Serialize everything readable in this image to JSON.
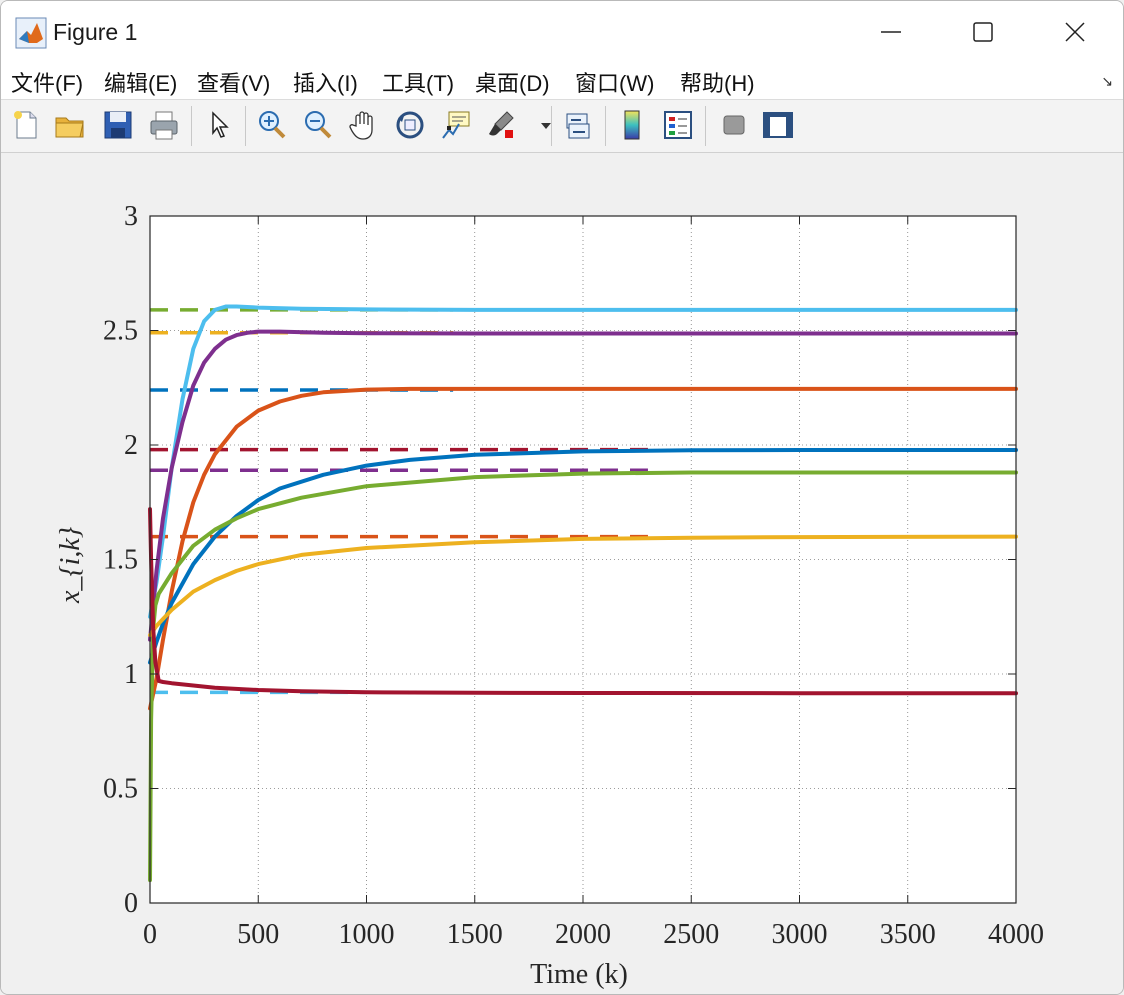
{
  "window": {
    "title": "Figure 1"
  },
  "menu": [
    "文件(F)",
    "编辑(E)",
    "查看(V)",
    "插入(I)",
    "工具(T)",
    "桌面(D)",
    "窗口(W)",
    "帮助(H)"
  ],
  "toolbar_icons": [
    "new-figure-icon",
    "open-file-icon",
    "save-icon",
    "print-icon",
    "select-arrow-icon",
    "zoom-in-icon",
    "zoom-out-icon",
    "pan-hand-icon",
    "rotate-3d-icon",
    "data-cursor-icon",
    "brush-icon",
    "brush-dropdown-icon",
    "link-plot-icon",
    "colorbar-icon",
    "legend-icon",
    "hide-plot-tools-icon",
    "show-plot-tools-icon"
  ],
  "chart_data": {
    "type": "line",
    "xlabel": "Time (k)",
    "ylabel": "x_{i,k}",
    "xlim": [
      0,
      4000
    ],
    "ylim": [
      0,
      3
    ],
    "xticks": [
      0,
      500,
      1000,
      1500,
      2000,
      2500,
      3000,
      3500,
      4000
    ],
    "yticks": [
      0,
      0.5,
      1,
      1.5,
      2,
      2.5,
      3
    ],
    "grid": true,
    "reference_lines": [
      {
        "value": 2.59,
        "color": "#77ac30",
        "x_end": 1400
      },
      {
        "value": 2.49,
        "color": "#edb120",
        "x_end": 1400
      },
      {
        "value": 2.24,
        "color": "#0072bd",
        "x_end": 1400
      },
      {
        "value": 1.98,
        "color": "#a2142f",
        "x_end": 2300
      },
      {
        "value": 1.89,
        "color": "#7e2f8e",
        "x_end": 2300
      },
      {
        "value": 1.6,
        "color": "#d95319",
        "x_end": 2300
      },
      {
        "value": 0.92,
        "color": "#4dbeee",
        "x_end": 1000
      }
    ],
    "series": [
      {
        "color": "#4dbeee",
        "x": [
          0,
          30,
          60,
          100,
          150,
          200,
          250,
          300,
          350,
          400,
          500,
          700,
          1000,
          1500,
          2000,
          3000,
          4000
        ],
        "y": [
          1.25,
          1.4,
          1.6,
          1.9,
          2.2,
          2.42,
          2.54,
          2.59,
          2.605,
          2.605,
          2.6,
          2.595,
          2.592,
          2.59,
          2.59,
          2.59,
          2.59
        ]
      },
      {
        "color": "#7e2f8e",
        "x": [
          0,
          30,
          60,
          100,
          150,
          200,
          250,
          300,
          350,
          400,
          450,
          500,
          600,
          800,
          1000,
          1500,
          2000,
          3000,
          4000
        ],
        "y": [
          1.15,
          1.45,
          1.68,
          1.9,
          2.1,
          2.26,
          2.36,
          2.42,
          2.46,
          2.48,
          2.49,
          2.495,
          2.495,
          2.49,
          2.488,
          2.487,
          2.487,
          2.487,
          2.487
        ]
      },
      {
        "color": "#d95319",
        "x": [
          0,
          30,
          60,
          100,
          150,
          200,
          250,
          300,
          400,
          500,
          600,
          700,
          800,
          1000,
          1200,
          1500,
          2000,
          3000,
          4000
        ],
        "y": [
          0.85,
          0.98,
          1.15,
          1.36,
          1.58,
          1.75,
          1.87,
          1.96,
          2.08,
          2.15,
          2.19,
          2.215,
          2.23,
          2.242,
          2.245,
          2.245,
          2.245,
          2.245,
          2.245
        ]
      },
      {
        "color": "#0072bd",
        "x": [
          0,
          30,
          60,
          100,
          200,
          300,
          400,
          500,
          600,
          800,
          1000,
          1200,
          1500,
          2000,
          2500,
          3000,
          4000
        ],
        "y": [
          1.05,
          1.14,
          1.22,
          1.31,
          1.48,
          1.6,
          1.69,
          1.76,
          1.81,
          1.87,
          1.91,
          1.935,
          1.957,
          1.972,
          1.977,
          1.978,
          1.978
        ]
      },
      {
        "color": "#77ac30",
        "x": [
          0,
          5,
          15,
          25,
          40,
          60,
          100,
          200,
          300,
          400,
          500,
          700,
          1000,
          1500,
          2000,
          2500,
          3000,
          4000
        ],
        "y": [
          0.1,
          0.8,
          1.2,
          1.3,
          1.35,
          1.38,
          1.44,
          1.56,
          1.63,
          1.68,
          1.72,
          1.77,
          1.82,
          1.86,
          1.875,
          1.88,
          1.88,
          1.88
        ]
      },
      {
        "color": "#edb120",
        "x": [
          0,
          30,
          60,
          100,
          200,
          300,
          400,
          500,
          700,
          1000,
          1500,
          2000,
          2500,
          3000,
          4000
        ],
        "y": [
          1.17,
          1.21,
          1.24,
          1.28,
          1.36,
          1.41,
          1.45,
          1.48,
          1.52,
          1.55,
          1.575,
          1.59,
          1.595,
          1.598,
          1.6
        ]
      },
      {
        "color": "#a2142f",
        "x": [
          0,
          5,
          15,
          25,
          40,
          60,
          100,
          200,
          300,
          500,
          700,
          1000,
          1500,
          2000,
          3000,
          4000
        ],
        "y": [
          1.72,
          1.5,
          1.2,
          1.05,
          0.97,
          0.965,
          0.96,
          0.95,
          0.94,
          0.93,
          0.925,
          0.92,
          0.918,
          0.917,
          0.916,
          0.916
        ]
      }
    ]
  }
}
